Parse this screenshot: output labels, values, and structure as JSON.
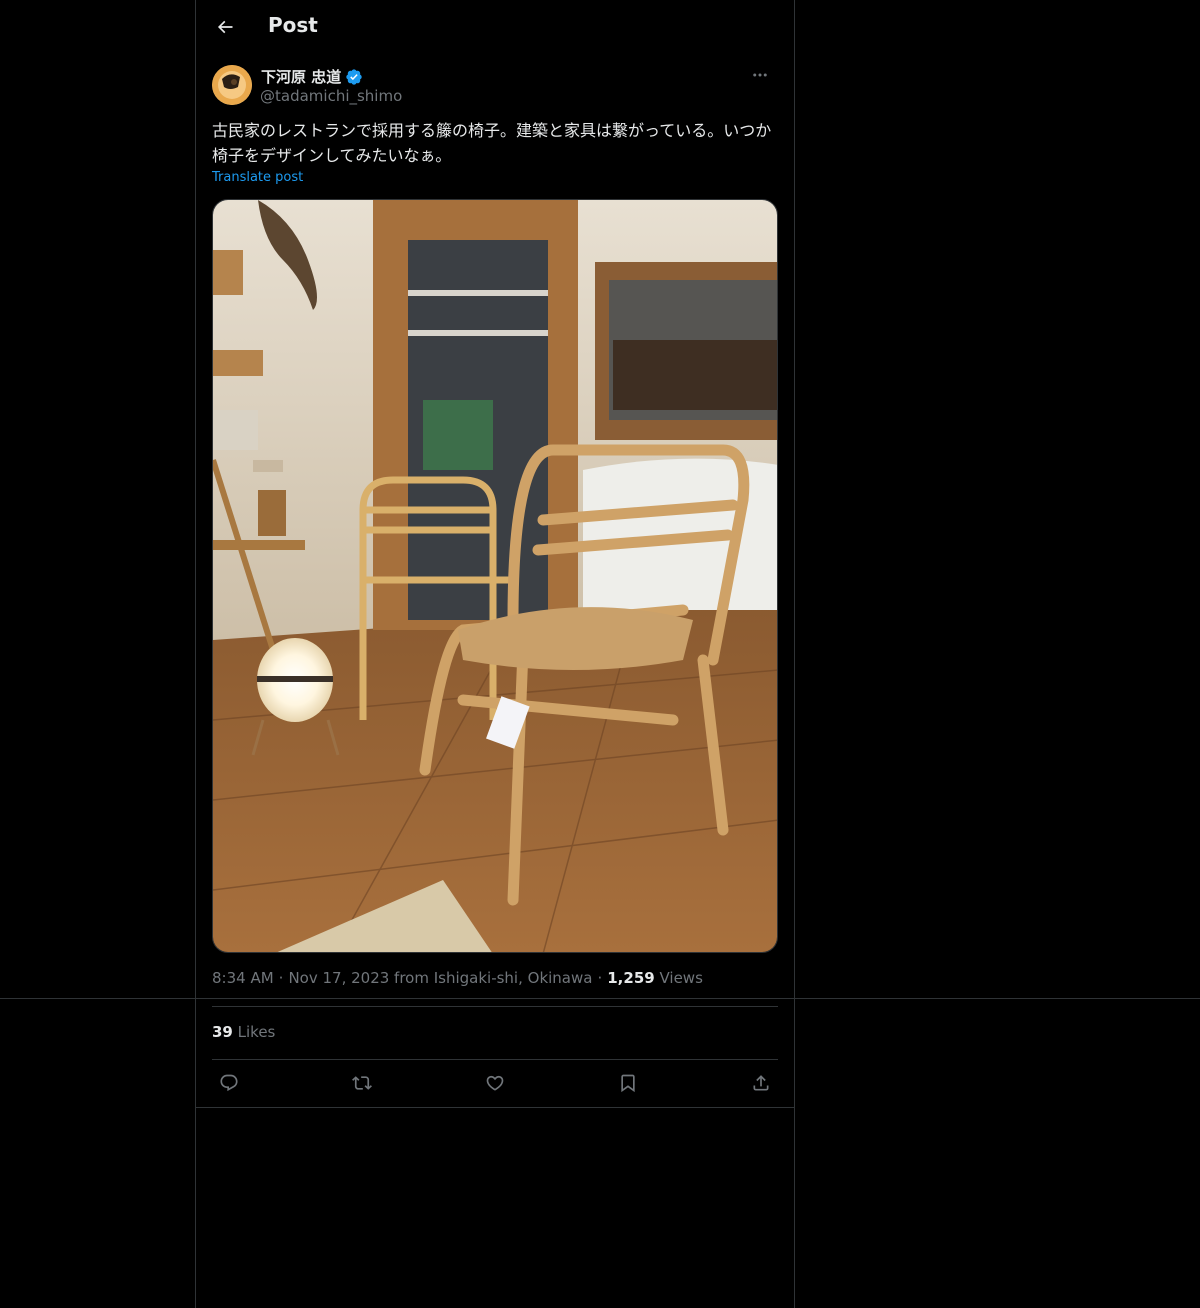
{
  "header": {
    "title": "Post",
    "back_icon": "arrow-left-icon"
  },
  "author": {
    "display_name": "下河原 忠道",
    "handle": "@tadamichi_shimo",
    "verified": true,
    "verified_color": "#1d9bf0"
  },
  "post": {
    "text": "古民家のレストランで採用する籐の椅子。建築と家具は繋がっている。いつか椅子をデザインしてみたいなぁ。",
    "translate_label": "Translate post",
    "media_description_icon": "photo-rattan-chair"
  },
  "meta": {
    "time": "8:34 AM",
    "separator": "·",
    "date_location": "Nov 17, 2023 from Ishigaki-shi, Okinawa",
    "views_count": "1,259",
    "views_label": "Views"
  },
  "stats": {
    "likes_count": "39",
    "likes_label": "Likes"
  },
  "actions": [
    {
      "name": "reply",
      "icon": "reply-icon"
    },
    {
      "name": "repost",
      "icon": "repost-icon"
    },
    {
      "name": "like",
      "icon": "heart-icon"
    },
    {
      "name": "bookmark",
      "icon": "bookmark-icon"
    },
    {
      "name": "share",
      "icon": "share-icon"
    }
  ],
  "colors": {
    "background": "#000000",
    "text": "#e7e9ea",
    "secondary": "#71767b",
    "accent": "#1d9bf0",
    "border": "#2f3336"
  }
}
